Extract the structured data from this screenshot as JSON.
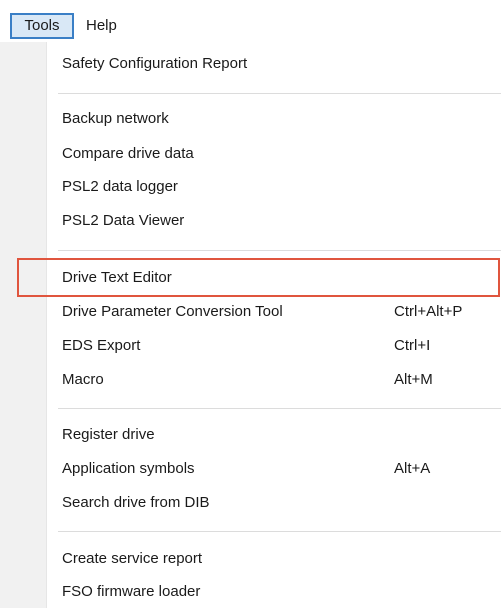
{
  "menubar": {
    "tools_label": "Tools",
    "help_label": "Help"
  },
  "menu": {
    "items": [
      {
        "label": "Safety Configuration Report",
        "shortcut": ""
      },
      {
        "label": "Backup network",
        "shortcut": ""
      },
      {
        "label": "Compare drive data",
        "shortcut": ""
      },
      {
        "label": "PSL2 data logger",
        "shortcut": ""
      },
      {
        "label": "PSL2 Data Viewer",
        "shortcut": ""
      },
      {
        "label": "Drive Text Editor",
        "shortcut": ""
      },
      {
        "label": "Drive Parameter Conversion Tool",
        "shortcut": "Ctrl+Alt+P"
      },
      {
        "label": "EDS Export",
        "shortcut": "Ctrl+I"
      },
      {
        "label": "Macro",
        "shortcut": "Alt+M"
      },
      {
        "label": "Register drive",
        "shortcut": ""
      },
      {
        "label": "Application symbols",
        "shortcut": "Alt+A"
      },
      {
        "label": "Search drive from DIB",
        "shortcut": ""
      },
      {
        "label": "Create service report",
        "shortcut": ""
      },
      {
        "label": "FSO firmware loader",
        "shortcut": ""
      }
    ]
  },
  "highlight_color": "#e0553e",
  "active_menu_color": "#d9e8f6"
}
